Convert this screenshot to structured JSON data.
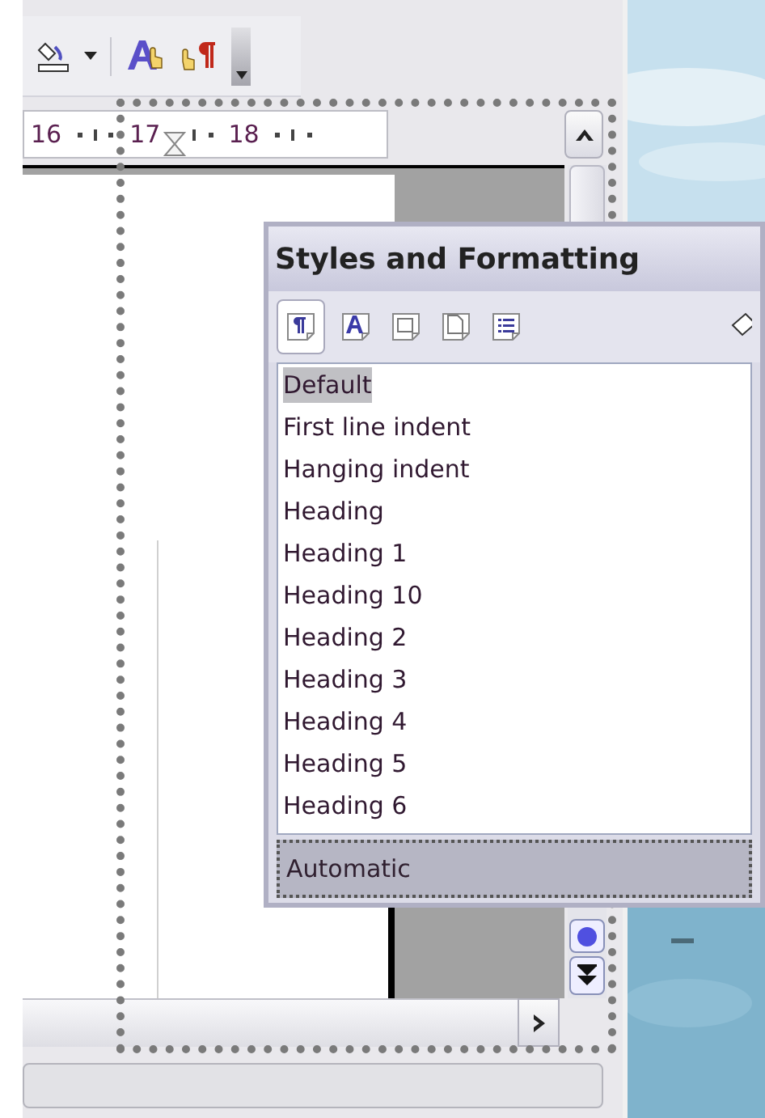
{
  "ruler": {
    "numbers": [
      "16",
      "17",
      "18"
    ]
  },
  "styles_window": {
    "title": "Styles and Formatting",
    "families": [
      {
        "kind": "paragraph",
        "selected": true
      },
      {
        "kind": "character",
        "selected": false
      },
      {
        "kind": "frame",
        "selected": false
      },
      {
        "kind": "page",
        "selected": false
      },
      {
        "kind": "list",
        "selected": false
      }
    ],
    "styles": [
      {
        "label": "Default",
        "selected": true
      },
      {
        "label": "First line indent",
        "selected": false
      },
      {
        "label": "Hanging indent",
        "selected": false
      },
      {
        "label": "Heading",
        "selected": false
      },
      {
        "label": "Heading 1",
        "selected": false
      },
      {
        "label": "Heading 10",
        "selected": false
      },
      {
        "label": "Heading 2",
        "selected": false
      },
      {
        "label": "Heading 3",
        "selected": false
      },
      {
        "label": "Heading 4",
        "selected": false
      },
      {
        "label": "Heading 5",
        "selected": false
      },
      {
        "label": "Heading 6",
        "selected": false
      }
    ],
    "filter": {
      "value": "Automatic"
    }
  }
}
